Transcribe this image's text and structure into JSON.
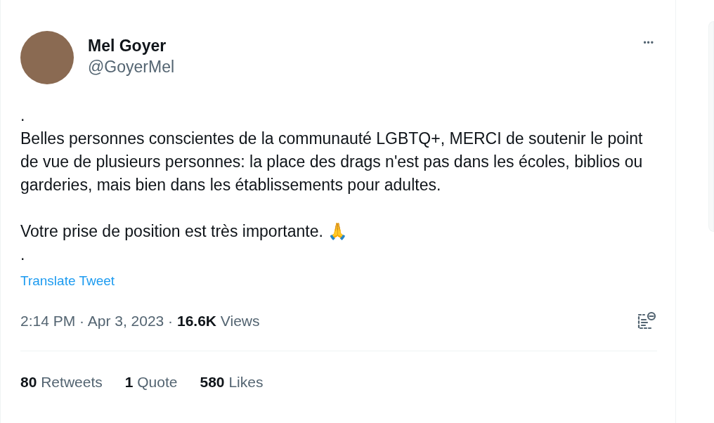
{
  "author": {
    "name": "Mel Goyer",
    "handle": "@GoyerMel",
    "more": "•••"
  },
  "body": [
    ".\nBelles personnes conscientes de la communauté LGBTQ+, MERCI de soutenir le point de vue de plusieurs personnes: la place des drags n'est pas dans les écoles, biblios ou garderies, mais bien dans les établissements pour adultes.",
    "Votre prise de position est très importante. 🙏\n."
  ],
  "translate": "Translate Tweet",
  "meta": "2:14 PM · Apr 3, 2023 · **16.6K** Views",
  "stats": [
    {
      "count": "80",
      "label": "Retweets"
    },
    {
      "count": "1",
      "label": "Quote"
    },
    {
      "count": "580",
      "label": "Likes"
    }
  ]
}
